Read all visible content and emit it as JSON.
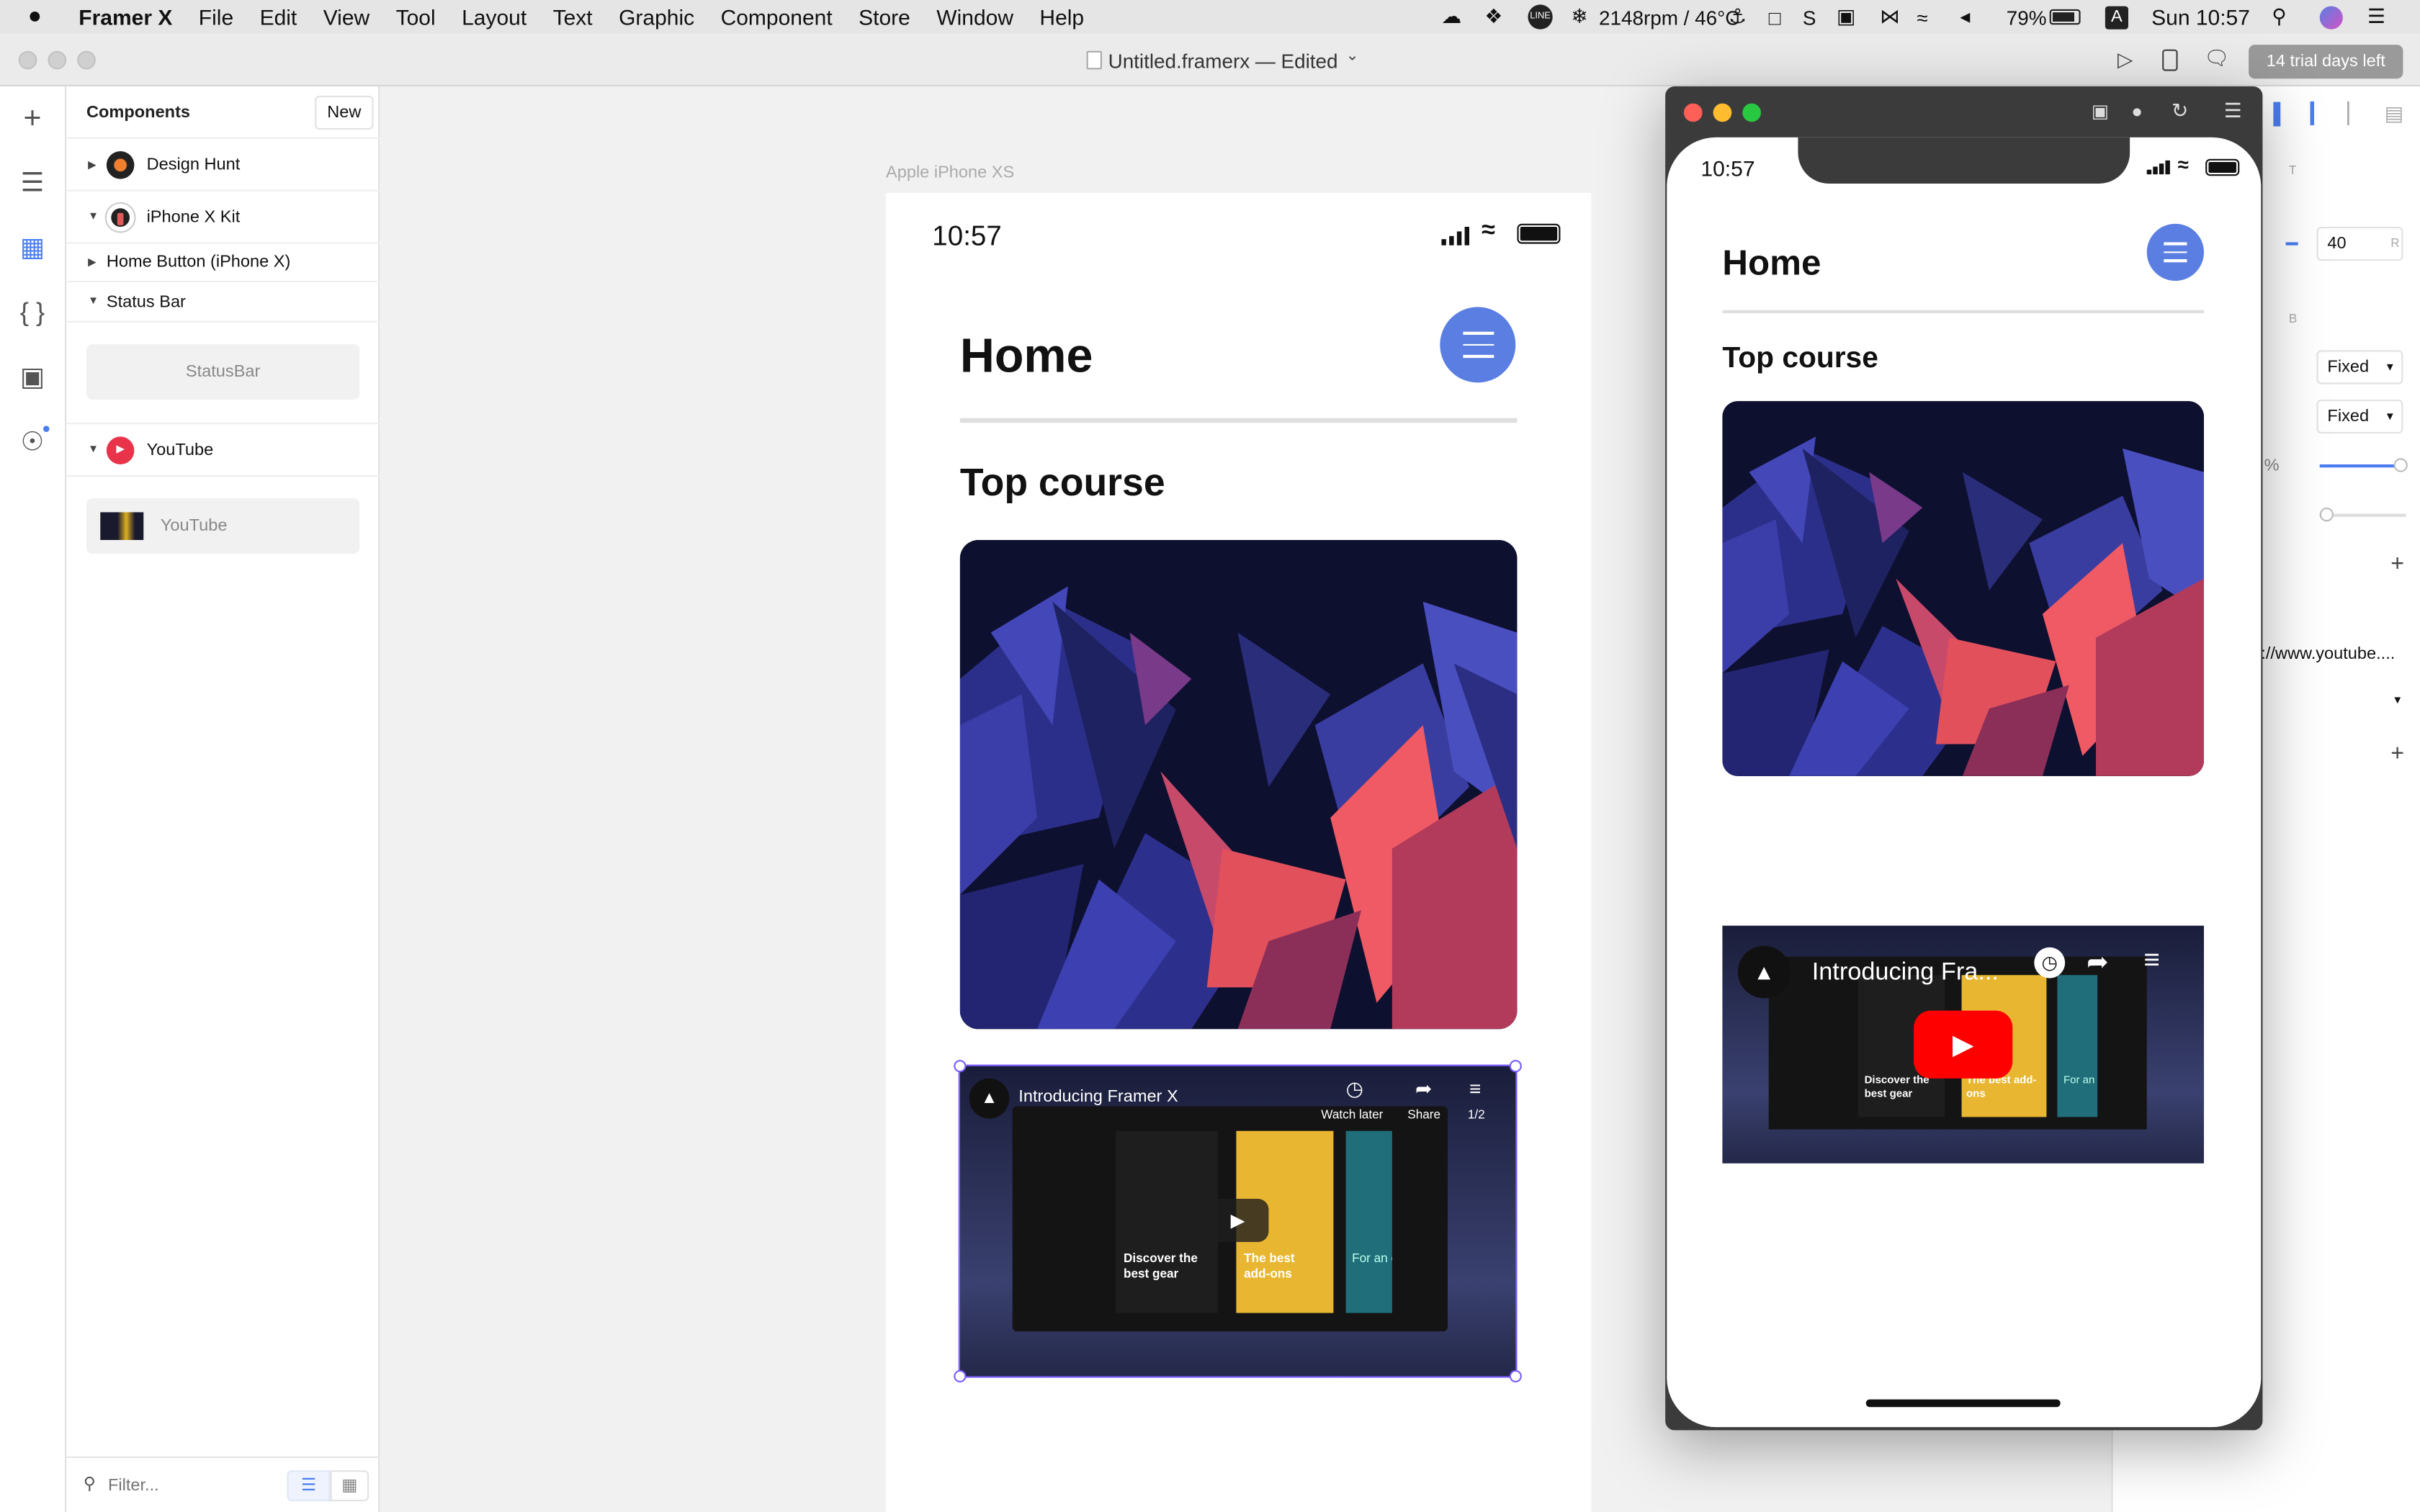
{
  "menubar": {
    "app": "Framer X",
    "items": [
      "File",
      "Edit",
      "View",
      "Tool",
      "Layout",
      "Text",
      "Graphic",
      "Component",
      "Store",
      "Window",
      "Help"
    ],
    "status_fan": "2148rpm / 46°C",
    "battery": "79%",
    "input_method": "A",
    "clock": "Sun 10:57"
  },
  "titlebar": {
    "doc_title": "Untitled.framerx — Edited",
    "trial": "14 trial days left"
  },
  "panel": {
    "title": "Components",
    "new_label": "New",
    "rows": [
      {
        "label": "Design Hunt"
      },
      {
        "label": "iPhone X Kit"
      },
      {
        "label": "Home Button (iPhone X)"
      },
      {
        "label": "Status Bar"
      },
      {
        "label": "YouTube"
      }
    ],
    "statusbar_card": "StatusBar",
    "youtube_card": "YouTube",
    "filter_placeholder": "Filter..."
  },
  "canvas": {
    "frame_label": "Apple iPhone XS",
    "time": "10:57",
    "home": "Home",
    "top_course": "Top course",
    "video": {
      "title": "Introducing Framer X",
      "watch_later": "Watch later",
      "share": "Share",
      "counter": "1/2",
      "card1": "Discover the best gear",
      "card2": "The best add-ons",
      "card3": "For an occa"
    }
  },
  "preview": {
    "time": "10:57",
    "home": "Home",
    "top_course": "Top course",
    "video_title": "Introducing Fra...",
    "card1": "Discover the best gear",
    "card2": "The best add-ons",
    "card3": "For an occas"
  },
  "inspector": {
    "radius_value": "40",
    "radius_letter": "R",
    "t_letter": "T",
    "b_letter": "B",
    "fixed1": "Fixed",
    "fixed2": "Fixed",
    "percent": "%",
    "url": "://www.youtube...."
  },
  "colors": {
    "accent": "#5b7ee2",
    "selection": "#7a5cff",
    "youtube_red": "#ff0000"
  }
}
